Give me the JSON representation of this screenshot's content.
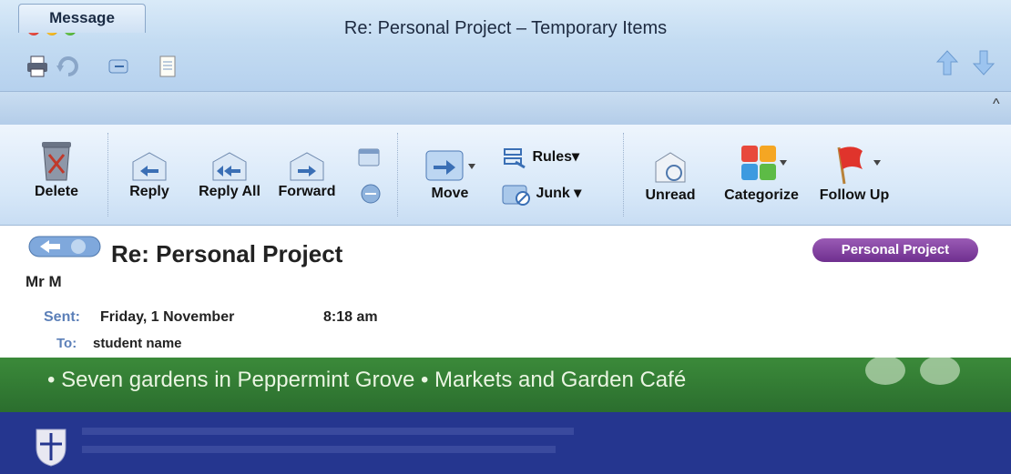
{
  "window": {
    "title": "Re: Personal Project – Temporary Items"
  },
  "toolbar_icons": [
    "printer-icon",
    "undo-icon",
    "redo-icon",
    "notes-icon"
  ],
  "tabs": [
    {
      "label": "Message"
    }
  ],
  "ribbon": {
    "delete": "Delete",
    "reply": "Reply",
    "reply_all": "Reply All",
    "forward": "Forward",
    "move": "Move",
    "rules": "Rules",
    "junk": "Junk",
    "unread": "Unread",
    "categorize": "Categorize",
    "follow_up": "Follow Up"
  },
  "message": {
    "subject": "Re: Personal Project",
    "sender": "Mr M",
    "sent_label": "Sent:",
    "sent_date": "Friday, 1 November",
    "sent_time": "8:18 am",
    "to_label": "To:",
    "to_value": "student name",
    "category_badge": "Personal Project"
  },
  "banner": {
    "text": "• Seven gardens in Peppermint Grove • Markets and Garden Café"
  },
  "colors": {
    "category_purple": "#7a3a9a",
    "banner_green": "#2f7431",
    "banner_blue": "#25368f",
    "label_blue": "#5b7fb8"
  }
}
